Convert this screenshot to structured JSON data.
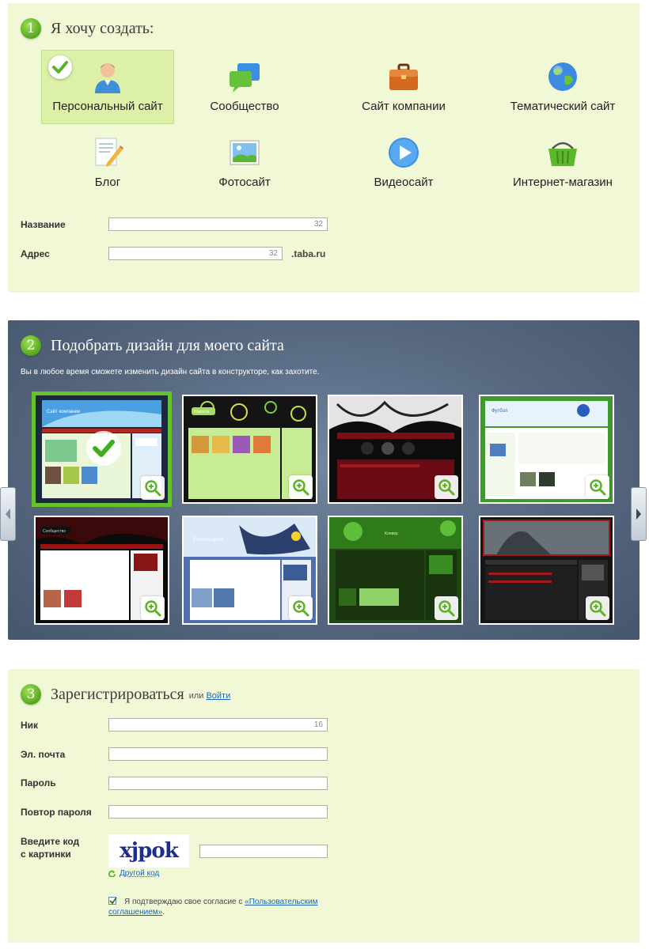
{
  "step1": {
    "number": "1",
    "title": "Я хочу создать:",
    "types": [
      {
        "label": "Персональный сайт",
        "icon": "person-icon",
        "selected": true
      },
      {
        "label": "Сообщество",
        "icon": "chat-bubbles-icon",
        "selected": false
      },
      {
        "label": "Сайт компании",
        "icon": "briefcase-icon",
        "selected": false
      },
      {
        "label": "Тематический сайт",
        "icon": "globe-icon",
        "selected": false
      },
      {
        "label": "Блог",
        "icon": "document-pencil-icon",
        "selected": false
      },
      {
        "label": "Фотосайт",
        "icon": "picture-icon",
        "selected": false
      },
      {
        "label": "Видеосайт",
        "icon": "play-icon",
        "selected": false
      },
      {
        "label": "Интернет-магазин",
        "icon": "basket-icon",
        "selected": false
      }
    ],
    "name_label": "Название",
    "name_counter": "32",
    "address_label": "Адрес",
    "address_counter": "32",
    "address_suffix": ".taba.ru"
  },
  "step2": {
    "number": "2",
    "title": "Подобрать дизайн для моего сайта",
    "subtitle": "Вы в любое время сможете изменить дизайн сайта в конструкторе, как захотите.",
    "designs": [
      {
        "name": "Сайт компании",
        "theme": "blue-green",
        "selected": true
      },
      {
        "name": "Новости",
        "theme": "dark-circles",
        "selected": false
      },
      {
        "name": "",
        "theme": "dark-red-grunge",
        "selected": false
      },
      {
        "name": "Футбол",
        "theme": "green-football",
        "selected": false
      },
      {
        "name": "Сообщество",
        "theme": "black-red",
        "selected": false
      },
      {
        "name": "Extreme sport",
        "theme": "blue-extreme",
        "selected": false
      },
      {
        "name": "Клевер",
        "theme": "green-clover",
        "selected": false
      },
      {
        "name": "",
        "theme": "dark-halo",
        "selected": false
      }
    ]
  },
  "step3": {
    "number": "3",
    "title": "Зарегистрироваться",
    "or_text": "или",
    "login_link": "Войти",
    "nick_label": "Ник",
    "nick_counter": "16",
    "email_label": "Эл. почта",
    "password_label": "Пароль",
    "password_repeat_label": "Повтор пароля",
    "captcha_label_line1": "Введите код",
    "captcha_label_line2": "с картинки",
    "captcha_text": "xjpok",
    "other_code": "Другой код",
    "agree_text": "Я подтверждаю свое согласие с",
    "agree_link": "«Пользовательским соглашением»",
    "agree_end": "."
  },
  "colors": {
    "panel_bg": "#f1f8d6",
    "selected_bg": "#dcf0a8",
    "accent_green": "#65c12c",
    "gallery_bg": "#56677f",
    "link": "#1a66b3"
  }
}
